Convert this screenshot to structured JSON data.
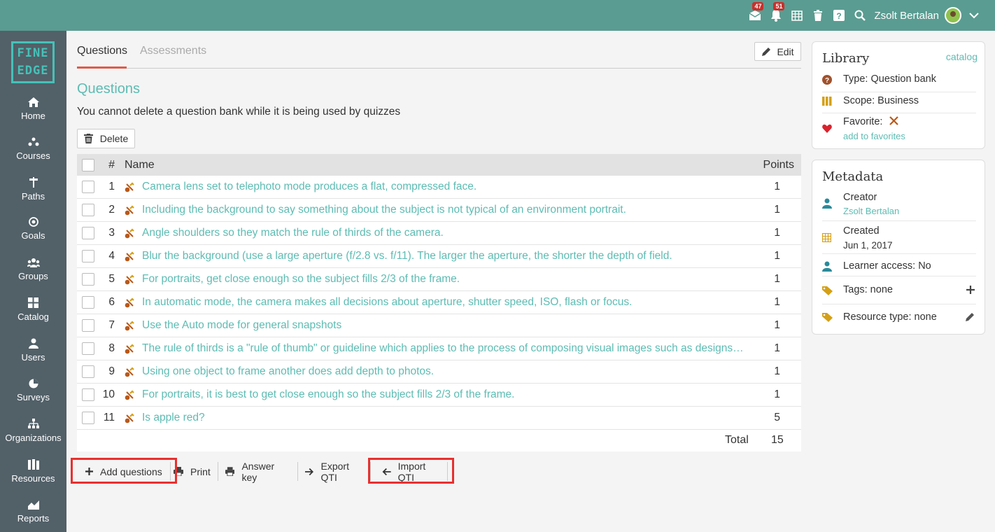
{
  "topbar": {
    "mail_badge": "47",
    "notif_badge": "51",
    "user_name": "Zsolt Bertalan"
  },
  "logo": {
    "line1": "FINE",
    "line2": "EDGE"
  },
  "sidebar": {
    "items": [
      {
        "label": "Home",
        "icon": "home-icon"
      },
      {
        "label": "Courses",
        "icon": "courses-icon"
      },
      {
        "label": "Paths",
        "icon": "signpost-icon"
      },
      {
        "label": "Goals",
        "icon": "target-icon"
      },
      {
        "label": "Groups",
        "icon": "group-icon"
      },
      {
        "label": "Catalog",
        "icon": "grid-icon"
      },
      {
        "label": "Users",
        "icon": "user-icon"
      },
      {
        "label": "Surveys",
        "icon": "pie-icon"
      },
      {
        "label": "Organizations",
        "icon": "org-icon"
      },
      {
        "label": "Resources",
        "icon": "books-icon"
      },
      {
        "label": "Reports",
        "icon": "chart-icon"
      }
    ]
  },
  "tabs": {
    "questions": "Questions",
    "assessments": "Assessments"
  },
  "edit_label": "Edit",
  "page": {
    "title": "Questions",
    "warning": "You cannot delete a question bank while it is being used by quizzes",
    "delete_label": "Delete"
  },
  "table": {
    "headers": {
      "num": "#",
      "name": "Name",
      "points": "Points"
    },
    "rows": [
      {
        "num": "1",
        "name": "Camera lens set to telephoto mode produces a flat, compressed face.",
        "points": "1"
      },
      {
        "num": "2",
        "name": "Including the background to say something about the subject is not typical of an environment portrait.",
        "points": "1"
      },
      {
        "num": "3",
        "name": "Angle shoulders so they match the rule of thirds of the camera.",
        "points": "1"
      },
      {
        "num": "4",
        "name": "Blur the background (use a large aperture (f/2.8 vs. f/11). The larger the aperture, the shorter the depth of field.",
        "points": "1"
      },
      {
        "num": "5",
        "name": "For portraits, get close enough so the subject fills 2/3 of the frame.",
        "points": "1"
      },
      {
        "num": "6",
        "name": "In automatic mode, the camera makes all decisions about aperture, shutter speed, ISO, flash or focus.",
        "points": "1"
      },
      {
        "num": "7",
        "name": "Use the Auto mode for general snapshots",
        "points": "1"
      },
      {
        "num": "8",
        "name": "The rule of thirds is a \"rule of thumb\" or guideline which applies to the process of composing visual images such as designs…",
        "points": "1"
      },
      {
        "num": "9",
        "name": "Using one object to frame another does add depth to photos.",
        "points": "1"
      },
      {
        "num": "10",
        "name": "For portraits, it is best to get close enough so the subject fills 2/3 of the frame.",
        "points": "1"
      },
      {
        "num": "11",
        "name": "Is apple red?",
        "points": "5"
      }
    ],
    "total_label": "Total",
    "total_value": "15"
  },
  "toolbar": {
    "add": "Add questions",
    "print": "Print",
    "answer_key": "Answer key",
    "export": "Export QTI",
    "import": "Import QTI"
  },
  "library": {
    "title": "Library",
    "catalog_link": "catalog",
    "type": "Type: Question bank",
    "scope": "Scope: Business",
    "favorite": "Favorite:",
    "add_favorites": "add to favorites"
  },
  "metadata": {
    "title": "Metadata",
    "creator_label": "Creator",
    "creator_value": "Zsolt Bertalan",
    "created_label": "Created",
    "created_value": "Jun 1, 2017",
    "learner_access": "Learner access: No",
    "tags": "Tags: none",
    "resource_type": "Resource type: none"
  },
  "colors": {
    "topbar": "#5a9c91",
    "sidebar": "#526068",
    "accent": "#5dbcb3",
    "highlight": "#e8302f",
    "tab_underline": "#e05a4a"
  }
}
